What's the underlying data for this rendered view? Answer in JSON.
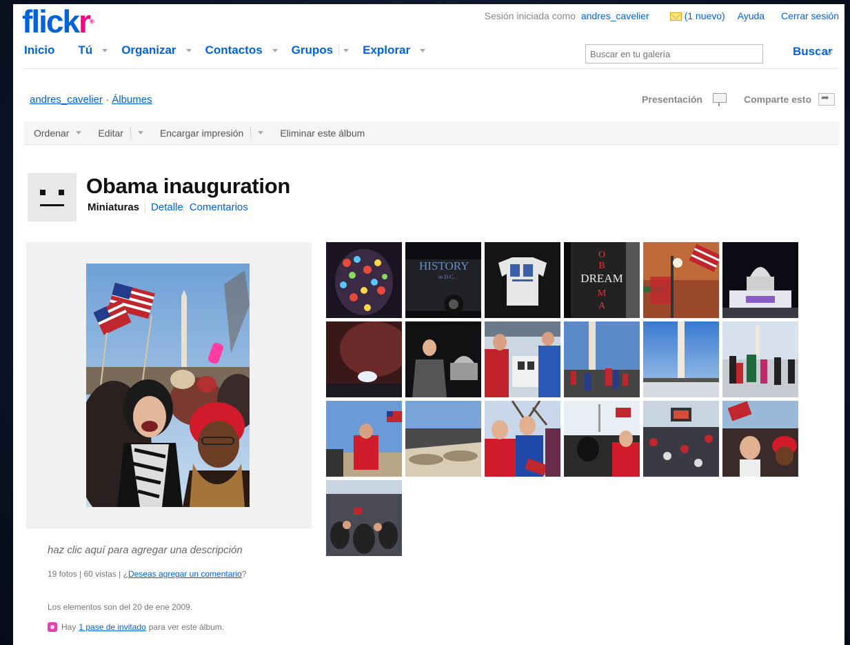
{
  "logo": {
    "part1": "flick",
    "part2": "r",
    "tm": "®"
  },
  "topbar": {
    "signed_in_prefix": "Sesión iniciada como",
    "username": "andres_cavelier",
    "mail_label": "(1 nuevo)",
    "help": "Ayuda",
    "logout": "Cerrar sesión"
  },
  "nav": {
    "home": "Inicio",
    "you": "Tú",
    "organize": "Organizar",
    "contacts": "Contactos",
    "groups": "Grupos",
    "explore": "Explorar"
  },
  "search": {
    "placeholder": "Buscar en tu galería",
    "button": "Buscar"
  },
  "breadcrumb": {
    "user": "andres_cavelier",
    "separator": "·",
    "section": "Álbumes"
  },
  "actions": {
    "slideshow": "Presentación",
    "share": "Comparte esto"
  },
  "toolbar": {
    "sort": "Ordenar",
    "edit": "Editar",
    "order_prints": "Encargar impresión",
    "delete_set": "Eliminar este álbum"
  },
  "set": {
    "title": "Obama inauguration",
    "tabs": {
      "thumbnails": "Miniaturas",
      "detail": "Detalle",
      "comments": "Comentarios"
    }
  },
  "details": {
    "description_prompt": "haz clic aquí para agregar una descripción",
    "stats_text": "19 fotos | 60 vistas | ¿",
    "comment_link": "Deseas agregar un comentario",
    "comment_suffix": "?",
    "dates": "Los elementos son del 20 de ene 2009.",
    "guest_prefix": "Hay",
    "guest_link": "1 pase de invitado",
    "guest_suffix": "para ver este álbum."
  },
  "colors": {
    "link_blue": "#0063dc",
    "brand_pink": "#ff0084"
  }
}
